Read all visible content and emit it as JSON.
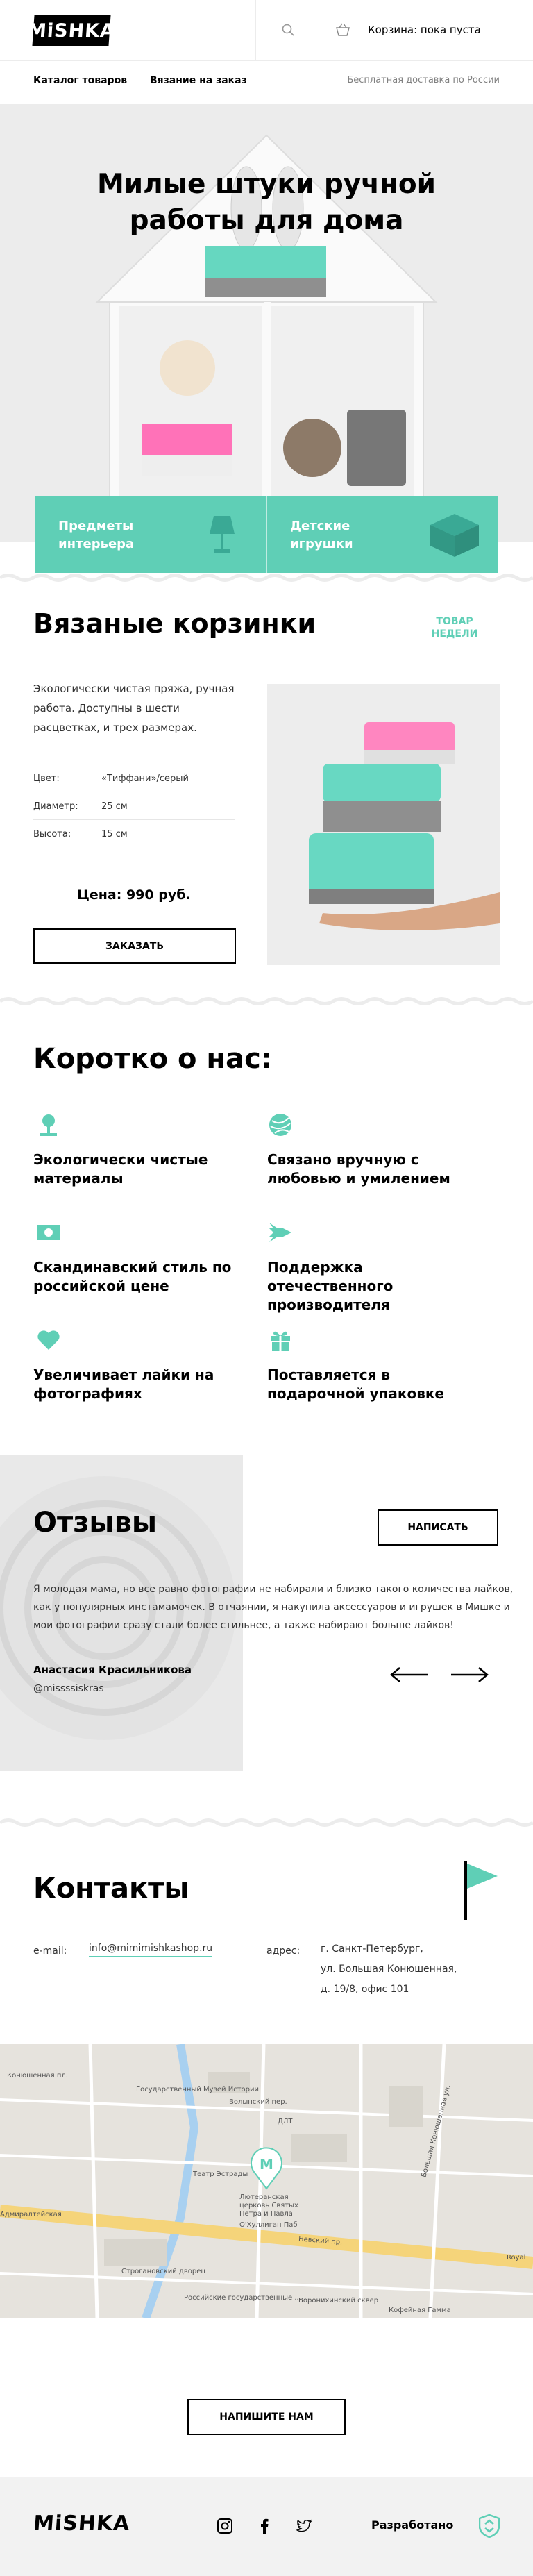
{
  "header": {
    "logo": "MiSHKA",
    "cart": "Корзина: пока пуста",
    "icons": [
      "search-icon",
      "basket-icon"
    ]
  },
  "nav": {
    "items": [
      "Каталог товаров",
      "Вязание на заказ"
    ],
    "shipping": "Бесплатная доставка по России"
  },
  "hero": {
    "title": "Милые штуки ручной работы для дома",
    "promos": [
      {
        "label": "Предметы интерьера",
        "icon": "lamp-icon"
      },
      {
        "label": "Детские игрушки",
        "icon": "toy-block-icon"
      }
    ]
  },
  "product": {
    "title": "Вязаные корзинки",
    "tag": "ТОВАР НЕДЕЛИ",
    "description": "Экологически чистая пряжа, ручная работа. Доступны в шести расцветках, и трех размерах.",
    "specs": [
      {
        "label": "Цвет:",
        "value": "«Тиффани»/серый"
      },
      {
        "label": "Диаметр:",
        "value": "25 см"
      },
      {
        "label": "Высота:",
        "value": "15 см"
      }
    ],
    "price": "Цена: 990 руб.",
    "order_button": "ЗАКАЗАТЬ"
  },
  "about": {
    "title": "Коротко о нас:",
    "features": [
      {
        "text": "Экологически чистые материалы",
        "icon": "flower-icon"
      },
      {
        "text": "Связано вручную с любовью и умилением",
        "icon": "yarn-ball-icon"
      },
      {
        "text": "Скандинавский стиль по российской цене",
        "icon": "banknote-icon"
      },
      {
        "text": "Поддержка отечественного производителя",
        "icon": "rocket-icon"
      },
      {
        "text": "Увеличивает лайки на фотографиях",
        "icon": "heart-icon"
      },
      {
        "text": "Поставляется в подарочной упаковке",
        "icon": "gift-icon"
      }
    ]
  },
  "reviews": {
    "title": "Отзывы",
    "write_button": "НАПИСАТЬ",
    "text": "Я молодая мама, но все равно фотографии не набирали и близко такого количества лайков, как у популярных инстамамочек. В отчаянии, я накупила аксессуаров и игрушек в Мишке и мои фотографии сразу стали более стильнее, а также набирают больше лайков!",
    "author": "Анастасия Красильникова",
    "handle": "@missssiskras"
  },
  "contacts": {
    "title": "Контакты",
    "email_label": "e-mail:",
    "email": "info@mimimishkashop.ru",
    "address_label": "адрес:",
    "address_lines": [
      "г. Санкт-Петербург,",
      "ул. Большая Конюшенная,",
      "д. 19/8, офис 101"
    ]
  },
  "map": {
    "labels": [
      "Государственный Музей Истории",
      "Театр Эстрады",
      "Невский пр.",
      "Строгановский дворец",
      "Российские государственные ...",
      "О'Хуллиган Паб",
      "ДЛТ",
      "Конюшенная пл.",
      "Большая Конюшенная ул.",
      "Волынский пер.",
      "Воронихинский сквер",
      "Кофейная Гамма",
      "Royal",
      "Адмиралтейская",
      "Лютеранская церковь Святых Петра и Павла"
    ],
    "marker": "M"
  },
  "write_us_button": "НАПИШИТЕ НАМ",
  "footer": {
    "logo": "MiSHKA",
    "developed": "Разработано",
    "social_icons": [
      "instagram-icon",
      "facebook-icon",
      "twitter-icon"
    ]
  },
  "colors": {
    "accent": "#5fcfb6",
    "text": "#000000",
    "muted": "#808080"
  }
}
